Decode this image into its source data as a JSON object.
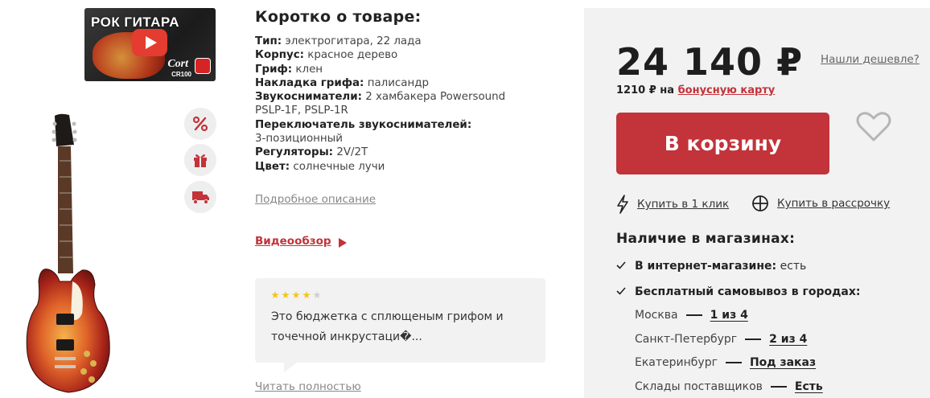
{
  "media": {
    "video_thumbnail": {
      "title": "РОК ГИТАРА",
      "brand": "Cort",
      "model": "CR100"
    },
    "side_icons": [
      "percent-icon",
      "gift-icon",
      "delivery-truck-icon"
    ]
  },
  "summary": {
    "title": "Коротко о товаре:",
    "specs": [
      {
        "label": "Тип:",
        "value": "электрогитара, 22 лада"
      },
      {
        "label": "Корпус:",
        "value": "красное дерево"
      },
      {
        "label": "Гриф:",
        "value": "клен"
      },
      {
        "label": "Накладка грифа:",
        "value": "палисандр"
      },
      {
        "label": "Звукосниматели:",
        "value": "2 хамбакера Powersound PSLP-1F, PSLP-1R"
      },
      {
        "label": "Переключатель звукоснимателей:",
        "value": "3-позиционный"
      },
      {
        "label": "Регуляторы:",
        "value": "2V/2T"
      },
      {
        "label": "Цвет:",
        "value": "солнечные лучи"
      }
    ],
    "more_link": "Подробное описание",
    "video_link": "Видеообзор"
  },
  "review": {
    "rating": 4,
    "max_rating": 5,
    "text": "Это бюджетка с сплющеным грифом и точечной инкрустаци�...",
    "read_more": "Читать полностью"
  },
  "buy": {
    "price": "24 140 ₽",
    "cheaper_link": "Нашли дешевле?",
    "bonus_amount": "1210 ₽ на",
    "bonus_link": "бонусную карту",
    "cart_button": "В корзину",
    "one_click": "Купить в 1 клик",
    "installments": "Купить в рассрочку"
  },
  "availability": {
    "title": "Наличие в магазинах:",
    "online_label": "В интернет-магазине:",
    "online_value": "есть",
    "pickup_label": "Бесплатный самовывоз в городах:",
    "cities": [
      {
        "name": "Москва",
        "value": "1 из 4"
      },
      {
        "name": "Санкт-Петербург",
        "value": "2 из 4"
      },
      {
        "name": "Екатеринбург",
        "value": "Под заказ"
      },
      {
        "name": "Склады поставщиков",
        "value": "Есть"
      }
    ]
  },
  "colors": {
    "accent": "#c2333a",
    "panel_bg": "#f2f2f2",
    "star": "#f5c518"
  }
}
